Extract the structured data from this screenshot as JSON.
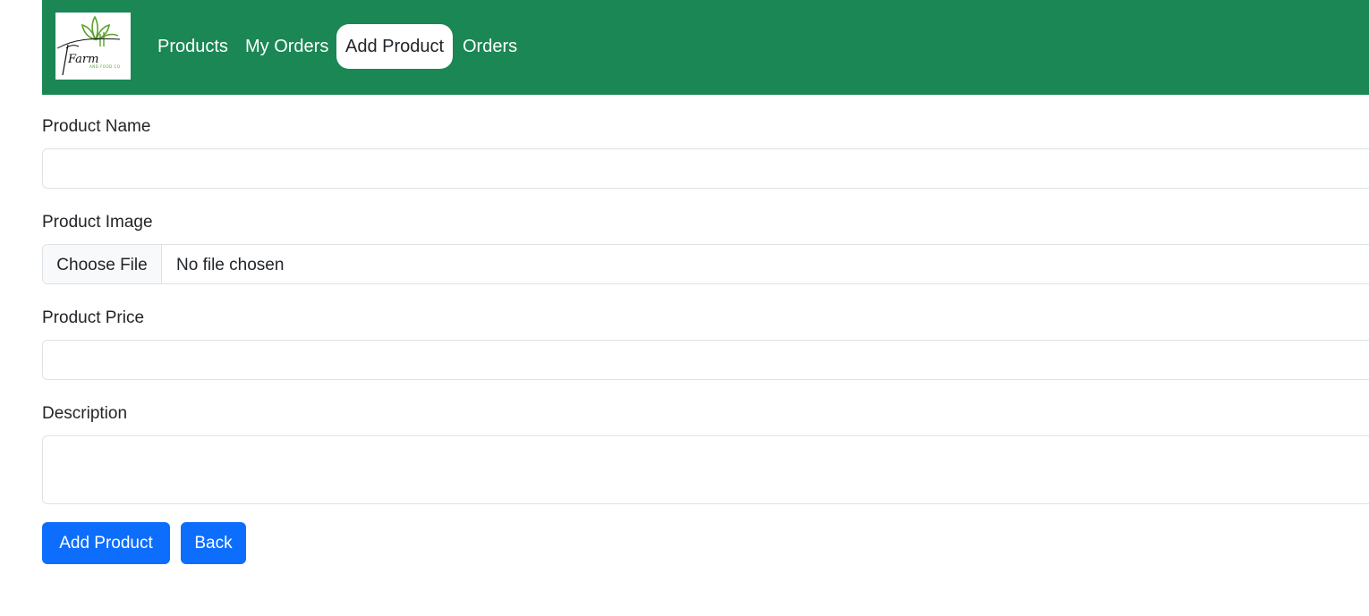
{
  "navbar": {
    "brand_text": "Farm",
    "brand_subtext": "AND FOOD CO",
    "links": [
      {
        "label": "Products",
        "active": false
      },
      {
        "label": "My Orders",
        "active": false
      },
      {
        "label": "Add Product",
        "active": true
      },
      {
        "label": "Orders",
        "active": false
      }
    ],
    "background_color": "#1a8754"
  },
  "form": {
    "product_name": {
      "label": "Product Name",
      "value": ""
    },
    "product_image": {
      "label": "Product Image",
      "button_label": "Choose File",
      "status": "No file chosen"
    },
    "product_price": {
      "label": "Product Price",
      "value": ""
    },
    "description": {
      "label": "Description",
      "value": ""
    }
  },
  "actions": {
    "submit_label": "Add Product",
    "back_label": "Back",
    "button_color": "#0d6efd"
  }
}
